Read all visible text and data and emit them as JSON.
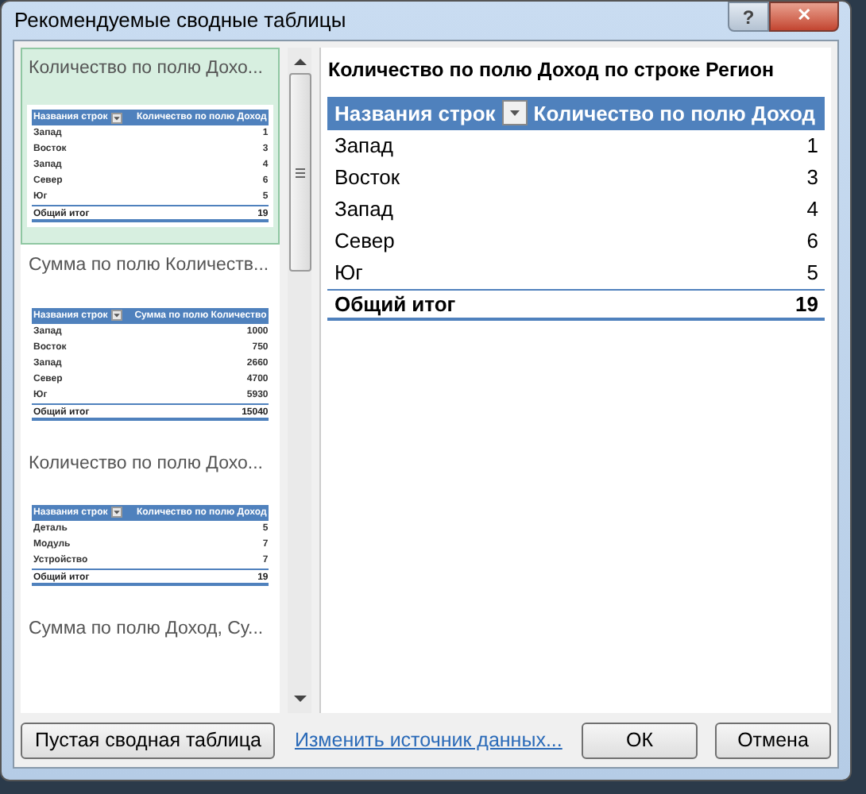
{
  "window": {
    "title": "Рекомендуемые сводные таблицы",
    "help": "?",
    "close": "✕"
  },
  "recommendations": [
    {
      "title": "Количество по полю Дохо...",
      "selected": true,
      "header": {
        "row_label": "Названия строк",
        "value_label": "Количество по полю Доход"
      },
      "rows": [
        {
          "label": "Запад",
          "value": "1"
        },
        {
          "label": "Восток",
          "value": "3"
        },
        {
          "label": "Запад",
          "value": "4"
        },
        {
          "label": "Север",
          "value": "6"
        },
        {
          "label": "Юг",
          "value": "5"
        }
      ],
      "total": {
        "label": "Общий итог",
        "value": "19"
      }
    },
    {
      "title": "Сумма по полю Количеств...",
      "selected": false,
      "header": {
        "row_label": "Названия строк",
        "value_label": "Сумма по полю Количество"
      },
      "rows": [
        {
          "label": "Запад",
          "value": "1000"
        },
        {
          "label": "Восток",
          "value": "750"
        },
        {
          "label": "Запад",
          "value": "2660"
        },
        {
          "label": "Север",
          "value": "4700"
        },
        {
          "label": "Юг",
          "value": "5930"
        }
      ],
      "total": {
        "label": "Общий итог",
        "value": "15040"
      }
    },
    {
      "title": "Количество по полю Дохо...",
      "selected": false,
      "header": {
        "row_label": "Названия строк",
        "value_label": "Количество по полю Доход"
      },
      "rows": [
        {
          "label": "Деталь",
          "value": "5"
        },
        {
          "label": "Модуль",
          "value": "7"
        },
        {
          "label": "Устройство",
          "value": "7"
        }
      ],
      "total": {
        "label": "Общий итог",
        "value": "19"
      }
    },
    {
      "title": "Сумма по полю Доход, Су...",
      "selected": false
    }
  ],
  "preview": {
    "title": "Количество по полю Доход по строке Регион",
    "header": {
      "row_label": "Названия строк",
      "value_label": "Количество по полю Доход"
    },
    "rows": [
      {
        "label": "Запад",
        "value": "1"
      },
      {
        "label": "Восток",
        "value": "3"
      },
      {
        "label": "Запад",
        "value": "4"
      },
      {
        "label": "Север",
        "value": "6"
      },
      {
        "label": "Юг",
        "value": "5"
      }
    ],
    "total": {
      "label": "Общий итог",
      "value": "19"
    }
  },
  "buttons": {
    "blank": "Пустая сводная таблица",
    "change_source": "Изменить источник данных...",
    "ok": "ОК",
    "cancel": "Отмена"
  }
}
